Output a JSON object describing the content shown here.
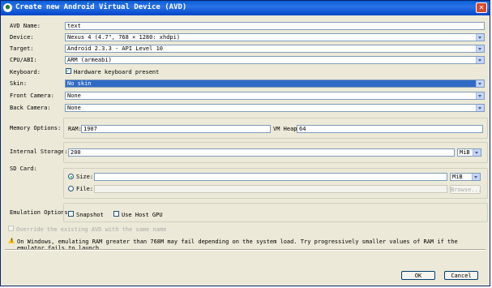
{
  "window": {
    "title": "Create new Android Virtual Device (AVD)",
    "close_glyph": "✕"
  },
  "avd_name": {
    "label": "AVD Name:",
    "value": "text"
  },
  "device": {
    "label": "Device:",
    "value": "Nexus 4 (4.7\", 768 × 1280: xhdpi)"
  },
  "target": {
    "label": "Target:",
    "value": "Android 2.3.3 - API Level 10"
  },
  "cpu_abi": {
    "label": "CPU/ABI:",
    "value": "ARM (armeabi)"
  },
  "keyboard": {
    "label": "Keyboard:",
    "checkbox_label": "Hardware keyboard present",
    "checked": true
  },
  "skin": {
    "label": "Skin:",
    "value": "No skin"
  },
  "front_camera": {
    "label": "Front Camera:",
    "value": "None"
  },
  "back_camera": {
    "label": "Back Camera:",
    "value": "None"
  },
  "memory": {
    "label": "Memory Options:",
    "ram_label": "RAM:",
    "ram_value": "1907",
    "vm_heap_label": "VM Heap:",
    "vm_heap_value": "64"
  },
  "internal_storage": {
    "label": "Internal Storage:",
    "value": "200",
    "unit": "MiB"
  },
  "sd_card": {
    "label": "SD Card:",
    "size_label": "Size:",
    "size_value": "",
    "size_unit": "MiB",
    "file_label": "File:",
    "file_value": "",
    "browse_label": "Browse..."
  },
  "emulation": {
    "label": "Emulation Options:",
    "snapshot_label": "Snapshot",
    "use_host_gpu_label": "Use Host GPU"
  },
  "override": {
    "label": "Override the existing AVD with the same name"
  },
  "warning": {
    "text": "On Windows, emulating RAM greater than 768M may fail depending on the system load. Try progressively smaller values of RAM if the emulator fails to launch."
  },
  "buttons": {
    "ok": "OK",
    "cancel": "Cancel"
  }
}
